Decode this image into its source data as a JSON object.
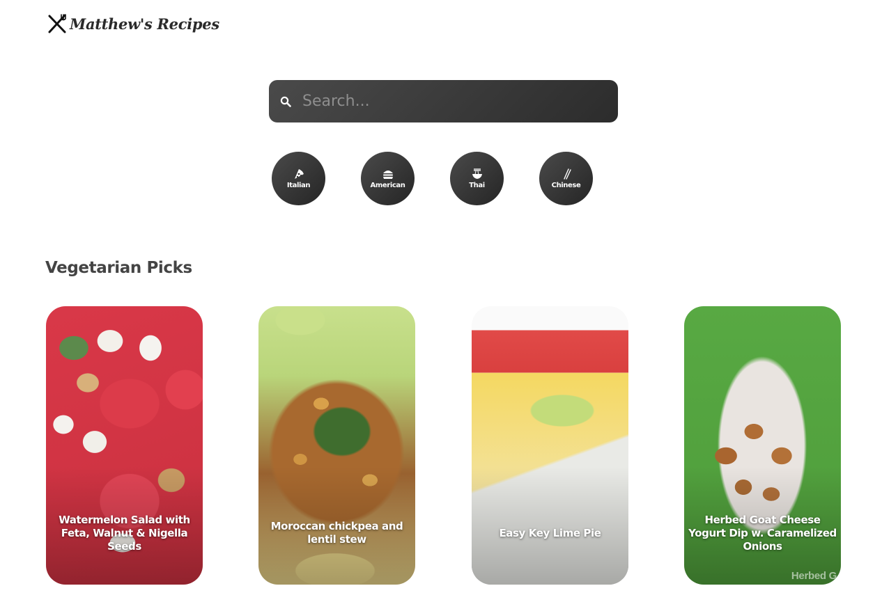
{
  "header": {
    "logo_text": "Matthew's Recipes",
    "logo_icon": "fork-knife-icon"
  },
  "search": {
    "placeholder": "Search...",
    "value": "",
    "icon": "search-icon"
  },
  "cuisines": [
    {
      "label": "Italian",
      "icon": "pizza-icon"
    },
    {
      "label": "American",
      "icon": "burger-icon"
    },
    {
      "label": "Thai",
      "icon": "noodle-bowl-icon"
    },
    {
      "label": "Chinese",
      "icon": "chopsticks-icon"
    }
  ],
  "section": {
    "title": "Vegetarian Picks"
  },
  "recipes": [
    {
      "title": "Watermelon Salad with Feta, Walnut & Nigella Seeds"
    },
    {
      "title": "Moroccan chickpea and lentil stew"
    },
    {
      "title": "Easy Key Lime Pie"
    },
    {
      "title": "Herbed Goat Cheese Yogurt Dip w. Caramelized Onions",
      "photo_watermark": "Herbed G"
    }
  ],
  "colors": {
    "search_bg": "#3a3a3a",
    "cuisine_bg": "#333333",
    "text_dark": "#444444"
  }
}
